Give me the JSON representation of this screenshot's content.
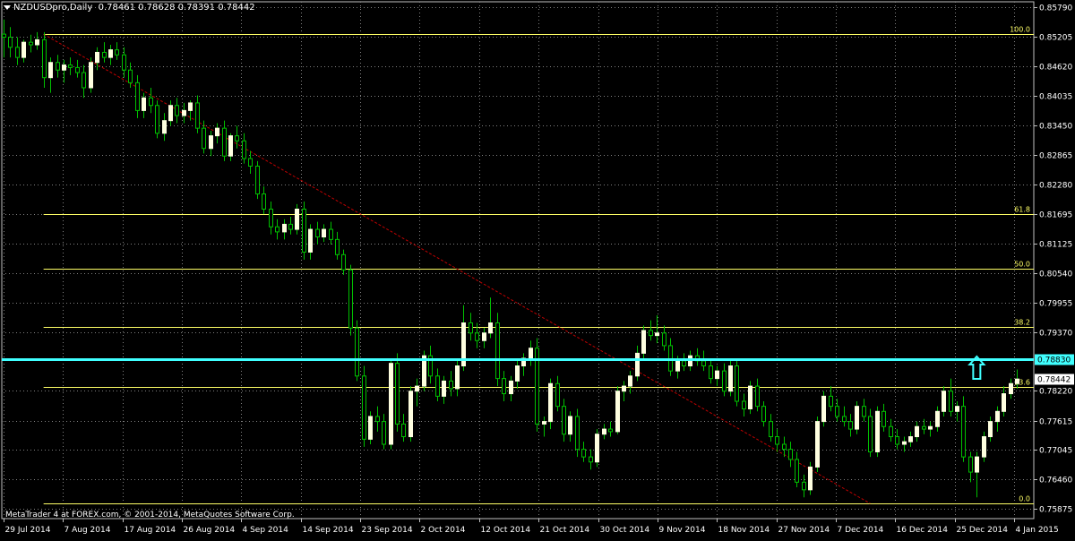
{
  "header": {
    "symbol": "NZDUSDpro,Daily",
    "ohlc": "0.78461 0.78628 0.78391 0.78442"
  },
  "copyright": "MetaTrader 4 at FOREX.com, © 2001-2014, MetaQuotes Software Corp.",
  "colors": {
    "background": "#000000",
    "grid": "#808080",
    "bull_candle": "#ffffe0",
    "wick": "#00c000",
    "fib_line": "#ffff66",
    "trend_line": "#c00000",
    "hline": "#40ffff",
    "arrow": "#40ffff"
  },
  "chart_data": {
    "type": "candlestick",
    "y_ticks": [
      "0.85790",
      "0.85205",
      "0.84620",
      "0.84035",
      "0.83450",
      "0.82865",
      "0.82280",
      "0.81695",
      "0.81125",
      "0.80540",
      "0.79955",
      "0.79370",
      "0.78220",
      "0.77615",
      "0.77045",
      "0.76460",
      "0.75875"
    ],
    "ylim": [
      0.7568,
      0.859
    ],
    "x_labels": [
      "29 Jul 2014",
      "7 Aug 2014",
      "17 Aug 2014",
      "26 Aug 2014",
      "4 Sep 2014",
      "14 Sep 2014",
      "23 Sep 2014",
      "2 Oct 2014",
      "12 Oct 2014",
      "21 Oct 2014",
      "30 Oct 2014",
      "9 Nov 2014",
      "18 Nov 2014",
      "27 Nov 2014",
      "7 Dec 2014",
      "16 Dec 2014",
      "25 Dec 2014",
      "4 Jan 2015"
    ],
    "current_price": {
      "label": "0.78442",
      "value": 0.78442
    },
    "horizontal_line": {
      "label": "0.78830",
      "value": 0.7883
    },
    "fibonacci": [
      {
        "level": "100.0",
        "value": 0.8526
      },
      {
        "level": "61.8",
        "value": 0.817
      },
      {
        "level": "50.0",
        "value": 0.8062
      },
      {
        "level": "38.2",
        "value": 0.7947
      },
      {
        "level": "23.6",
        "value": 0.7828
      },
      {
        "level": "0.0",
        "value": 0.7598
      }
    ],
    "trendline": {
      "from_index": 6,
      "from_value": 0.8526,
      "to_index": 130,
      "to_value": 0.7598
    },
    "candles": [
      {
        "o": 0.8526,
        "h": 0.8555,
        "l": 0.848,
        "c": 0.852
      },
      {
        "o": 0.852,
        "h": 0.854,
        "l": 0.848,
        "c": 0.85
      },
      {
        "o": 0.85,
        "h": 0.852,
        "l": 0.8465,
        "c": 0.848
      },
      {
        "o": 0.848,
        "h": 0.8515,
        "l": 0.847,
        "c": 0.851
      },
      {
        "o": 0.851,
        "h": 0.8525,
        "l": 0.849,
        "c": 0.8505
      },
      {
        "o": 0.8505,
        "h": 0.853,
        "l": 0.8495,
        "c": 0.8515
      },
      {
        "o": 0.8515,
        "h": 0.853,
        "l": 0.842,
        "c": 0.844
      },
      {
        "o": 0.844,
        "h": 0.848,
        "l": 0.841,
        "c": 0.847
      },
      {
        "o": 0.847,
        "h": 0.8485,
        "l": 0.844,
        "c": 0.8455
      },
      {
        "o": 0.8455,
        "h": 0.8475,
        "l": 0.843,
        "c": 0.8465
      },
      {
        "o": 0.8465,
        "h": 0.848,
        "l": 0.8445,
        "c": 0.846
      },
      {
        "o": 0.846,
        "h": 0.8475,
        "l": 0.844,
        "c": 0.845
      },
      {
        "o": 0.845,
        "h": 0.8465,
        "l": 0.84,
        "c": 0.842
      },
      {
        "o": 0.842,
        "h": 0.848,
        "l": 0.841,
        "c": 0.847
      },
      {
        "o": 0.847,
        "h": 0.85,
        "l": 0.8455,
        "c": 0.849
      },
      {
        "o": 0.849,
        "h": 0.851,
        "l": 0.847,
        "c": 0.848
      },
      {
        "o": 0.848,
        "h": 0.8505,
        "l": 0.8465,
        "c": 0.8495
      },
      {
        "o": 0.8495,
        "h": 0.851,
        "l": 0.8475,
        "c": 0.8485
      },
      {
        "o": 0.8485,
        "h": 0.85,
        "l": 0.844,
        "c": 0.8455
      },
      {
        "o": 0.8455,
        "h": 0.847,
        "l": 0.842,
        "c": 0.843
      },
      {
        "o": 0.843,
        "h": 0.8445,
        "l": 0.836,
        "c": 0.8375
      },
      {
        "o": 0.8375,
        "h": 0.841,
        "l": 0.836,
        "c": 0.84
      },
      {
        "o": 0.84,
        "h": 0.842,
        "l": 0.837,
        "c": 0.8385
      },
      {
        "o": 0.8385,
        "h": 0.8395,
        "l": 0.832,
        "c": 0.833
      },
      {
        "o": 0.833,
        "h": 0.837,
        "l": 0.8315,
        "c": 0.8355
      },
      {
        "o": 0.8355,
        "h": 0.8395,
        "l": 0.8345,
        "c": 0.8385
      },
      {
        "o": 0.8385,
        "h": 0.84,
        "l": 0.835,
        "c": 0.8365
      },
      {
        "o": 0.8365,
        "h": 0.839,
        "l": 0.835,
        "c": 0.8375
      },
      {
        "o": 0.8375,
        "h": 0.8395,
        "l": 0.8355,
        "c": 0.839
      },
      {
        "o": 0.839,
        "h": 0.8405,
        "l": 0.833,
        "c": 0.834
      },
      {
        "o": 0.834,
        "h": 0.8355,
        "l": 0.829,
        "c": 0.83
      },
      {
        "o": 0.83,
        "h": 0.8335,
        "l": 0.8285,
        "c": 0.8325
      },
      {
        "o": 0.8325,
        "h": 0.835,
        "l": 0.831,
        "c": 0.834
      },
      {
        "o": 0.834,
        "h": 0.8355,
        "l": 0.8275,
        "c": 0.8285
      },
      {
        "o": 0.8285,
        "h": 0.833,
        "l": 0.8275,
        "c": 0.8325
      },
      {
        "o": 0.8325,
        "h": 0.8345,
        "l": 0.83,
        "c": 0.8315
      },
      {
        "o": 0.8315,
        "h": 0.833,
        "l": 0.827,
        "c": 0.828
      },
      {
        "o": 0.828,
        "h": 0.8295,
        "l": 0.825,
        "c": 0.8265
      },
      {
        "o": 0.8265,
        "h": 0.8275,
        "l": 0.82,
        "c": 0.821
      },
      {
        "o": 0.821,
        "h": 0.8225,
        "l": 0.817,
        "c": 0.818
      },
      {
        "o": 0.818,
        "h": 0.8195,
        "l": 0.813,
        "c": 0.8145
      },
      {
        "o": 0.8145,
        "h": 0.816,
        "l": 0.812,
        "c": 0.8135
      },
      {
        "o": 0.8135,
        "h": 0.816,
        "l": 0.812,
        "c": 0.815
      },
      {
        "o": 0.815,
        "h": 0.8165,
        "l": 0.813,
        "c": 0.814
      },
      {
        "o": 0.814,
        "h": 0.819,
        "l": 0.813,
        "c": 0.818
      },
      {
        "o": 0.818,
        "h": 0.8195,
        "l": 0.808,
        "c": 0.8095
      },
      {
        "o": 0.8095,
        "h": 0.815,
        "l": 0.808,
        "c": 0.814
      },
      {
        "o": 0.814,
        "h": 0.8155,
        "l": 0.811,
        "c": 0.8125
      },
      {
        "o": 0.8125,
        "h": 0.815,
        "l": 0.8115,
        "c": 0.814
      },
      {
        "o": 0.814,
        "h": 0.8155,
        "l": 0.811,
        "c": 0.812
      },
      {
        "o": 0.812,
        "h": 0.8135,
        "l": 0.808,
        "c": 0.809
      },
      {
        "o": 0.809,
        "h": 0.81,
        "l": 0.805,
        "c": 0.806
      },
      {
        "o": 0.806,
        "h": 0.807,
        "l": 0.793,
        "c": 0.7945
      },
      {
        "o": 0.7945,
        "h": 0.796,
        "l": 0.784,
        "c": 0.785
      },
      {
        "o": 0.785,
        "h": 0.787,
        "l": 0.771,
        "c": 0.7725
      },
      {
        "o": 0.7725,
        "h": 0.778,
        "l": 0.7715,
        "c": 0.777
      },
      {
        "o": 0.777,
        "h": 0.779,
        "l": 0.774,
        "c": 0.776
      },
      {
        "o": 0.776,
        "h": 0.7775,
        "l": 0.7705,
        "c": 0.7715
      },
      {
        "o": 0.7715,
        "h": 0.7885,
        "l": 0.7705,
        "c": 0.7875
      },
      {
        "o": 0.7875,
        "h": 0.7895,
        "l": 0.774,
        "c": 0.7755
      },
      {
        "o": 0.7755,
        "h": 0.7775,
        "l": 0.772,
        "c": 0.773
      },
      {
        "o": 0.773,
        "h": 0.783,
        "l": 0.772,
        "c": 0.782
      },
      {
        "o": 0.782,
        "h": 0.7845,
        "l": 0.779,
        "c": 0.783
      },
      {
        "o": 0.783,
        "h": 0.79,
        "l": 0.782,
        "c": 0.789
      },
      {
        "o": 0.789,
        "h": 0.791,
        "l": 0.7835,
        "c": 0.785
      },
      {
        "o": 0.785,
        "h": 0.7865,
        "l": 0.78,
        "c": 0.781
      },
      {
        "o": 0.781,
        "h": 0.785,
        "l": 0.7795,
        "c": 0.784
      },
      {
        "o": 0.784,
        "h": 0.786,
        "l": 0.781,
        "c": 0.7825
      },
      {
        "o": 0.7825,
        "h": 0.788,
        "l": 0.781,
        "c": 0.787
      },
      {
        "o": 0.787,
        "h": 0.799,
        "l": 0.786,
        "c": 0.7955
      },
      {
        "o": 0.7955,
        "h": 0.7975,
        "l": 0.792,
        "c": 0.7935
      },
      {
        "o": 0.7935,
        "h": 0.7955,
        "l": 0.7905,
        "c": 0.792
      },
      {
        "o": 0.792,
        "h": 0.7945,
        "l": 0.7905,
        "c": 0.7935
      },
      {
        "o": 0.7935,
        "h": 0.8005,
        "l": 0.7925,
        "c": 0.7955
      },
      {
        "o": 0.7955,
        "h": 0.7975,
        "l": 0.783,
        "c": 0.7845
      },
      {
        "o": 0.7845,
        "h": 0.786,
        "l": 0.78,
        "c": 0.7815
      },
      {
        "o": 0.7815,
        "h": 0.785,
        "l": 0.78,
        "c": 0.784
      },
      {
        "o": 0.784,
        "h": 0.788,
        "l": 0.7825,
        "c": 0.787
      },
      {
        "o": 0.787,
        "h": 0.7895,
        "l": 0.785,
        "c": 0.7885
      },
      {
        "o": 0.7885,
        "h": 0.792,
        "l": 0.787,
        "c": 0.7905
      },
      {
        "o": 0.7905,
        "h": 0.7925,
        "l": 0.774,
        "c": 0.7755
      },
      {
        "o": 0.7755,
        "h": 0.777,
        "l": 0.773,
        "c": 0.776
      },
      {
        "o": 0.776,
        "h": 0.7845,
        "l": 0.7745,
        "c": 0.7835
      },
      {
        "o": 0.7835,
        "h": 0.785,
        "l": 0.778,
        "c": 0.779
      },
      {
        "o": 0.779,
        "h": 0.7805,
        "l": 0.772,
        "c": 0.7735
      },
      {
        "o": 0.7735,
        "h": 0.778,
        "l": 0.772,
        "c": 0.777
      },
      {
        "o": 0.777,
        "h": 0.7785,
        "l": 0.769,
        "c": 0.7705
      },
      {
        "o": 0.7705,
        "h": 0.772,
        "l": 0.768,
        "c": 0.769
      },
      {
        "o": 0.769,
        "h": 0.7705,
        "l": 0.7665,
        "c": 0.768
      },
      {
        "o": 0.768,
        "h": 0.7745,
        "l": 0.767,
        "c": 0.7735
      },
      {
        "o": 0.7735,
        "h": 0.7755,
        "l": 0.7725,
        "c": 0.7745
      },
      {
        "o": 0.7745,
        "h": 0.776,
        "l": 0.773,
        "c": 0.774
      },
      {
        "o": 0.774,
        "h": 0.783,
        "l": 0.7735,
        "c": 0.782
      },
      {
        "o": 0.782,
        "h": 0.784,
        "l": 0.78,
        "c": 0.783
      },
      {
        "o": 0.783,
        "h": 0.786,
        "l": 0.7815,
        "c": 0.785
      },
      {
        "o": 0.785,
        "h": 0.791,
        "l": 0.784,
        "c": 0.7895
      },
      {
        "o": 0.7895,
        "h": 0.795,
        "l": 0.788,
        "c": 0.794
      },
      {
        "o": 0.794,
        "h": 0.796,
        "l": 0.792,
        "c": 0.793
      },
      {
        "o": 0.793,
        "h": 0.797,
        "l": 0.7915,
        "c": 0.7935
      },
      {
        "o": 0.7935,
        "h": 0.795,
        "l": 0.79,
        "c": 0.791
      },
      {
        "o": 0.791,
        "h": 0.7925,
        "l": 0.785,
        "c": 0.786
      },
      {
        "o": 0.786,
        "h": 0.789,
        "l": 0.7845,
        "c": 0.788
      },
      {
        "o": 0.788,
        "h": 0.7895,
        "l": 0.786,
        "c": 0.787
      },
      {
        "o": 0.787,
        "h": 0.79,
        "l": 0.786,
        "c": 0.789
      },
      {
        "o": 0.789,
        "h": 0.7905,
        "l": 0.787,
        "c": 0.788
      },
      {
        "o": 0.788,
        "h": 0.79,
        "l": 0.786,
        "c": 0.787
      },
      {
        "o": 0.787,
        "h": 0.7885,
        "l": 0.7835,
        "c": 0.7845
      },
      {
        "o": 0.7845,
        "h": 0.787,
        "l": 0.783,
        "c": 0.786
      },
      {
        "o": 0.786,
        "h": 0.7875,
        "l": 0.781,
        "c": 0.782
      },
      {
        "o": 0.782,
        "h": 0.788,
        "l": 0.781,
        "c": 0.787
      },
      {
        "o": 0.787,
        "h": 0.7885,
        "l": 0.779,
        "c": 0.78
      },
      {
        "o": 0.78,
        "h": 0.7815,
        "l": 0.777,
        "c": 0.7785
      },
      {
        "o": 0.7785,
        "h": 0.784,
        "l": 0.7775,
        "c": 0.783
      },
      {
        "o": 0.783,
        "h": 0.7845,
        "l": 0.778,
        "c": 0.779
      },
      {
        "o": 0.779,
        "h": 0.78,
        "l": 0.775,
        "c": 0.776
      },
      {
        "o": 0.776,
        "h": 0.7775,
        "l": 0.772,
        "c": 0.773
      },
      {
        "o": 0.773,
        "h": 0.7745,
        "l": 0.77,
        "c": 0.7715
      },
      {
        "o": 0.7715,
        "h": 0.773,
        "l": 0.769,
        "c": 0.7705
      },
      {
        "o": 0.7705,
        "h": 0.772,
        "l": 0.767,
        "c": 0.7685
      },
      {
        "o": 0.7685,
        "h": 0.77,
        "l": 0.763,
        "c": 0.764
      },
      {
        "o": 0.764,
        "h": 0.7655,
        "l": 0.761,
        "c": 0.7625
      },
      {
        "o": 0.7625,
        "h": 0.768,
        "l": 0.7615,
        "c": 0.767
      },
      {
        "o": 0.767,
        "h": 0.777,
        "l": 0.766,
        "c": 0.776
      },
      {
        "o": 0.776,
        "h": 0.782,
        "l": 0.775,
        "c": 0.781
      },
      {
        "o": 0.781,
        "h": 0.783,
        "l": 0.778,
        "c": 0.779
      },
      {
        "o": 0.779,
        "h": 0.7805,
        "l": 0.776,
        "c": 0.777
      },
      {
        "o": 0.777,
        "h": 0.779,
        "l": 0.775,
        "c": 0.776
      },
      {
        "o": 0.776,
        "h": 0.7775,
        "l": 0.773,
        "c": 0.7745
      },
      {
        "o": 0.7745,
        "h": 0.78,
        "l": 0.7735,
        "c": 0.779
      },
      {
        "o": 0.779,
        "h": 0.7805,
        "l": 0.776,
        "c": 0.777
      },
      {
        "o": 0.777,
        "h": 0.7785,
        "l": 0.769,
        "c": 0.77
      },
      {
        "o": 0.77,
        "h": 0.779,
        "l": 0.769,
        "c": 0.778
      },
      {
        "o": 0.778,
        "h": 0.7795,
        "l": 0.774,
        "c": 0.775
      },
      {
        "o": 0.775,
        "h": 0.7765,
        "l": 0.772,
        "c": 0.773
      },
      {
        "o": 0.773,
        "h": 0.7745,
        "l": 0.7705,
        "c": 0.7715
      },
      {
        "o": 0.7715,
        "h": 0.773,
        "l": 0.77,
        "c": 0.772
      },
      {
        "o": 0.772,
        "h": 0.774,
        "l": 0.771,
        "c": 0.773
      },
      {
        "o": 0.773,
        "h": 0.776,
        "l": 0.772,
        "c": 0.775
      },
      {
        "o": 0.775,
        "h": 0.7765,
        "l": 0.7735,
        "c": 0.7745
      },
      {
        "o": 0.7745,
        "h": 0.776,
        "l": 0.773,
        "c": 0.775
      },
      {
        "o": 0.775,
        "h": 0.779,
        "l": 0.774,
        "c": 0.778
      },
      {
        "o": 0.778,
        "h": 0.783,
        "l": 0.777,
        "c": 0.782
      },
      {
        "o": 0.782,
        "h": 0.7845,
        "l": 0.777,
        "c": 0.778
      },
      {
        "o": 0.778,
        "h": 0.78,
        "l": 0.776,
        "c": 0.779
      },
      {
        "o": 0.779,
        "h": 0.781,
        "l": 0.768,
        "c": 0.769
      },
      {
        "o": 0.769,
        "h": 0.77,
        "l": 0.764,
        "c": 0.766
      },
      {
        "o": 0.766,
        "h": 0.77,
        "l": 0.761,
        "c": 0.769
      },
      {
        "o": 0.769,
        "h": 0.774,
        "l": 0.768,
        "c": 0.773
      },
      {
        "o": 0.773,
        "h": 0.777,
        "l": 0.772,
        "c": 0.776
      },
      {
        "o": 0.776,
        "h": 0.779,
        "l": 0.774,
        "c": 0.778
      },
      {
        "o": 0.778,
        "h": 0.783,
        "l": 0.777,
        "c": 0.7815
      },
      {
        "o": 0.7815,
        "h": 0.7845,
        "l": 0.7805,
        "c": 0.7835
      },
      {
        "o": 0.7835,
        "h": 0.7863,
        "l": 0.7825,
        "c": 0.7844
      }
    ]
  }
}
